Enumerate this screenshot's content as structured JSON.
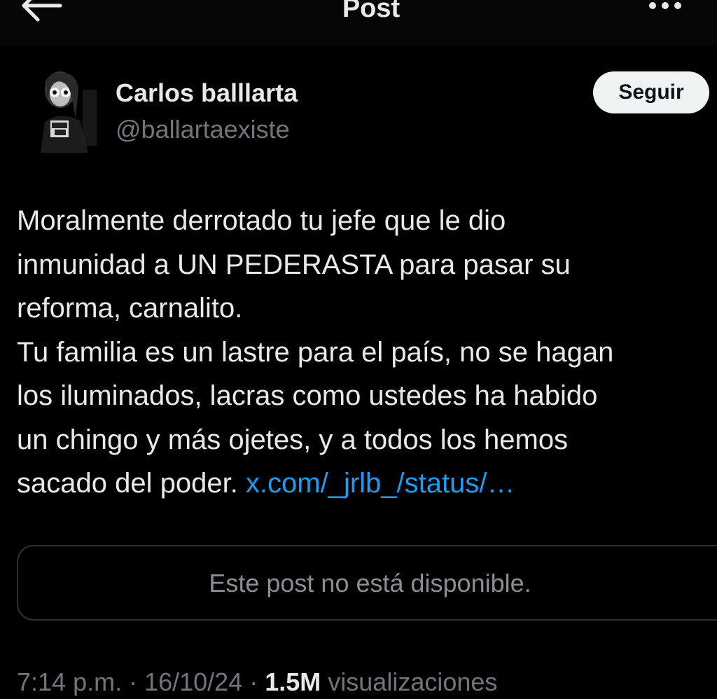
{
  "header": {
    "title": "Post",
    "back_icon": "arrow-left-icon",
    "more_icon": "more-horizontal-icon"
  },
  "author": {
    "name": "Carlos balllarta",
    "handle": "@ballartaexiste",
    "avatar_icon": "user-avatar"
  },
  "follow_button": {
    "label": "Seguir"
  },
  "tweet": {
    "lines": [
      "Moralmente derrotado tu jefe que le dio",
      "inmunidad a UN PEDERASTA para pasar su",
      "reforma, carnalito.",
      "Tu familia es un lastre para el país, no se hagan",
      "los iluminados, lacras como ustedes ha habido",
      "un chingo y más ojetes, y a todos los hemos",
      "sacado del poder. "
    ],
    "link_text": "x.com/_jrlb_/status/…"
  },
  "quote_card": {
    "message": "Este post no está disponible."
  },
  "meta": {
    "time": "7:14 p.m.",
    "sep1": " · ",
    "date": "16/10/24",
    "sep2": " · ",
    "views_count": "1.5M",
    "views_label": " visualizaciones"
  },
  "colors": {
    "background": "#000000",
    "text": "#e7e9ea",
    "muted": "#71767b",
    "link": "#1d9bf0",
    "follow_bg": "#eff3f4",
    "border": "#2f3336"
  }
}
